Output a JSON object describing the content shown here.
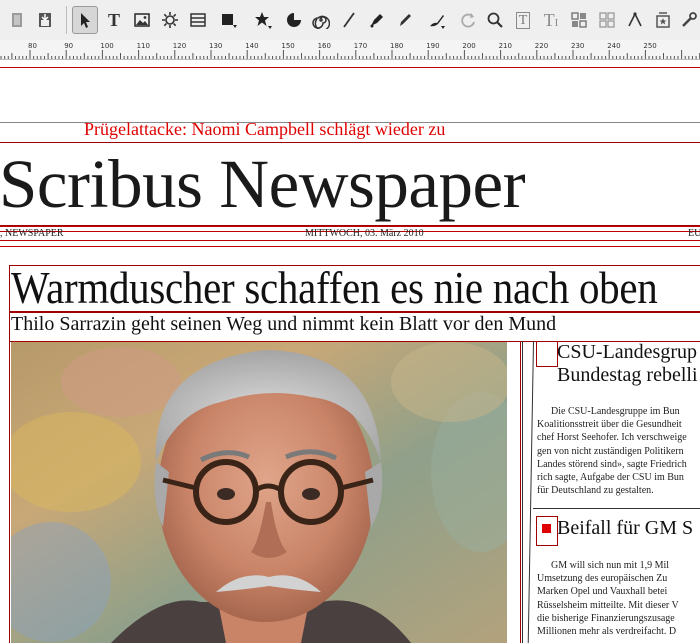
{
  "toolbar": {
    "tools": [
      {
        "name": "close-document-icon"
      },
      {
        "name": "save-document-icon"
      },
      {
        "name": "select-item-icon"
      },
      {
        "name": "text-frame-icon"
      },
      {
        "name": "image-frame-icon"
      },
      {
        "name": "render-frame-icon"
      },
      {
        "name": "table-icon"
      },
      {
        "name": "shape-icon"
      },
      {
        "name": "polygon-icon"
      },
      {
        "name": "arc-icon"
      },
      {
        "name": "spiral-icon"
      },
      {
        "name": "line-icon"
      },
      {
        "name": "bezier-icon"
      },
      {
        "name": "freehand-icon"
      },
      {
        "name": "calligraphic-icon"
      },
      {
        "name": "rotate-icon"
      },
      {
        "name": "zoom-icon"
      },
      {
        "name": "edit-text-icon"
      },
      {
        "name": "story-editor-icon"
      },
      {
        "name": "link-frames-icon"
      },
      {
        "name": "unlink-frames-icon"
      },
      {
        "name": "measure-icon"
      },
      {
        "name": "eyedropper-icon"
      },
      {
        "name": "pdf-tools-icon"
      }
    ]
  },
  "ruler": {
    "labels": [
      "80",
      "90",
      "100",
      "110",
      "120",
      "130",
      "140",
      "150",
      "160",
      "170",
      "180",
      "190",
      "200",
      "210",
      "220",
      "230",
      "240",
      "250"
    ]
  },
  "page": {
    "kicker": "Prügelattacke: Naomi Campbell schlägt wieder zu",
    "masthead": "Scribus Newspaper",
    "info_left": ", NEWSPAPER",
    "info_date": "MITTWOCH, 03. März 2010",
    "info_right": "EU",
    "headline": "Warmduscher schaffen es nie nach oben",
    "subhead": "Thilo Sarrazin geht seinen Weg und nimmt kein Blatt vor den Mund",
    "article1": {
      "head_line1": "CSU-Landesgrup",
      "head_line2": "Bundestag rebelli",
      "body": [
        "Die CSU-Landesgruppe im Bun",
        "Koalitionsstreit über die Gesundheit",
        "chef Horst Seehofer. Ich verschweige",
        "gen von nicht zuständigen Politikern",
        "Landes störend sind», sagte Friedrich",
        "rich sagte, Aufgabe der CSU im Bun",
        "für Deutschland zu gestalten."
      ]
    },
    "article2": {
      "head": "Beifall für GM S",
      "body": [
        "GM will sich nun mit 1,9 Mil",
        "Umsetzung des europäischen Zu",
        "Marken Opel und Vauxhall betei",
        "Rüsselsheim mitteilte. Mit dieser V",
        "die bisherige Finanzierungszusage",
        "Millionen mehr als verdreifacht. D"
      ]
    }
  },
  "colors": {
    "frame_red": "#a00000",
    "kicker_red": "#e00000",
    "text": "#111111"
  }
}
